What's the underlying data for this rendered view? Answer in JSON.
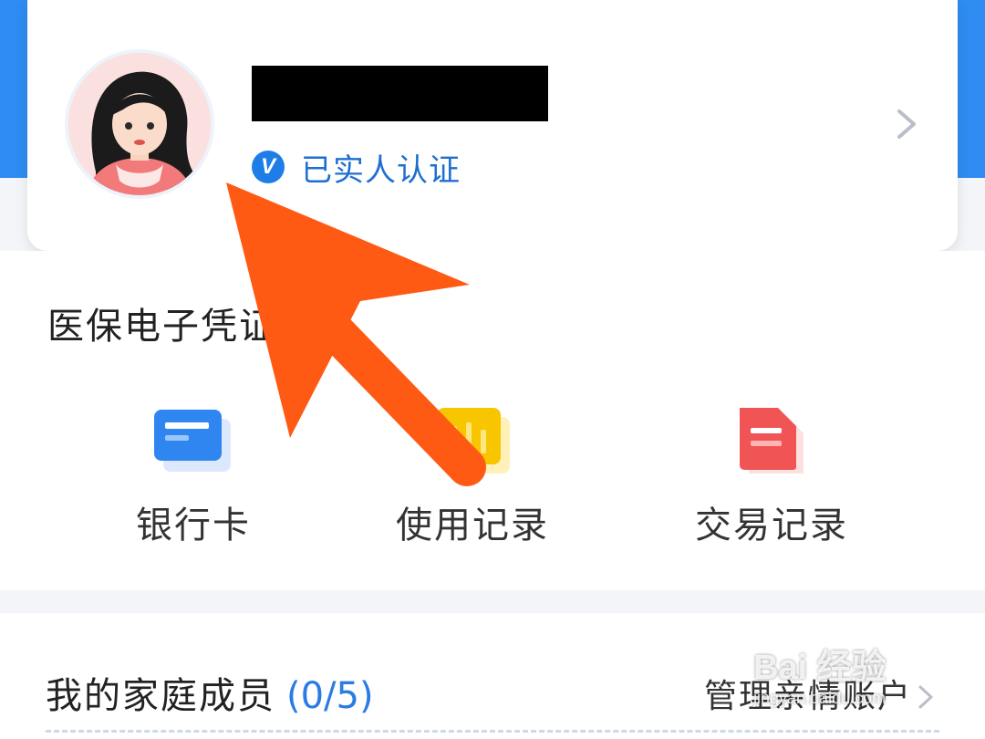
{
  "profile": {
    "verify_badge_glyph": "V",
    "verify_text": "已实人认证"
  },
  "voucher": {
    "title": "医保电子凭证",
    "features": [
      {
        "label": "银行卡",
        "icon": "bank-card-icon",
        "color": "#2f86f0"
      },
      {
        "label": "使用记录",
        "icon": "usage-record-icon",
        "color": "#f7c600"
      },
      {
        "label": "交易记录",
        "icon": "transaction-record-icon",
        "color": "#f05454"
      }
    ]
  },
  "family": {
    "title": "我的家庭成员",
    "count": "(0/5)",
    "manage_label": "管理亲情账户"
  },
  "watermark": {
    "main": "Bai 经验",
    "sub": "jingyan.baidu.com"
  },
  "colors": {
    "brand_blue": "#2f8cf2",
    "accent_blue": "#1e7de6",
    "arrow": "#ff5a14"
  }
}
